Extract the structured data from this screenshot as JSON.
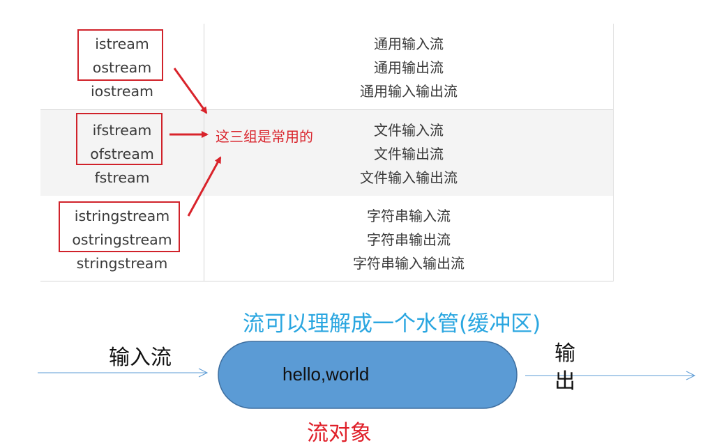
{
  "table": {
    "rows": [
      {
        "left": [
          "istream",
          "ostream",
          "iostream"
        ],
        "right": [
          "通用输入流",
          "通用输出流",
          "通用输入输出流"
        ]
      },
      {
        "left": [
          "ifstream",
          "ofstream",
          "fstream"
        ],
        "right": [
          "文件输入流",
          "文件输出流",
          "文件输入输出流"
        ]
      },
      {
        "left": [
          "istringstream",
          "ostringstream",
          "stringstream"
        ],
        "right": [
          "字符串输入流",
          "字符串输出流",
          "字符串输入输出流"
        ]
      }
    ]
  },
  "annotation": {
    "text": "这三组是常用的",
    "color": "#d9232b"
  },
  "pipe": {
    "title": "流可以理解成一个水管(缓冲区)",
    "input_label": "输入流",
    "output_label_line1": "输",
    "output_label_line2": "出",
    "content": "hello,world",
    "object_label": "流对象",
    "fill_color": "#5b9bd5",
    "title_color": "#2aa6e0"
  }
}
